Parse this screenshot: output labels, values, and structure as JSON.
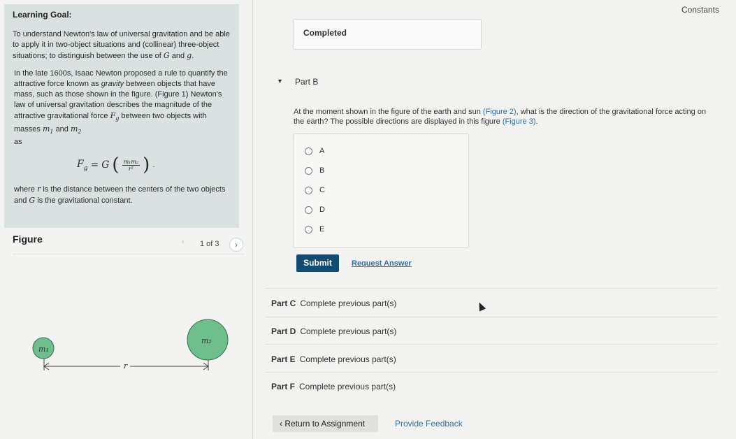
{
  "goal": {
    "title": "Learning Goal:",
    "intro_a": "To understand Newton's law of universal gravitation and be able to apply it in two-object situations and (collinear) three-object situations; to distinguish between the use of",
    "intro_G": "G",
    "intro_and": "and",
    "intro_g": "g",
    "intro_end": ".",
    "body_a": "In the late 1600s, Isaac Newton proposed a rule to quantify the attractive force known as",
    "body_gravity": "gravity",
    "body_b": "between objects that have mass, such as those shown in the figure. (Figure 1) Newton's law of universal gravitation describes the magnitude of the attractive gravitational force",
    "body_F": "F",
    "body_c": "between two objects with masses",
    "body_m1": "m",
    "body_and": "and",
    "body_m2": "m",
    "body_d": "as",
    "eq_lhs": "F",
    "eq_G": "G",
    "eq_num": "m₁m₂",
    "eq_den": "r²",
    "where_a": "where",
    "where_r": "r",
    "where_b": "is the distance between the centers of the two objects and",
    "where_G": "G",
    "where_c": "is the gravitational constant."
  },
  "figure": {
    "title": "Figure",
    "pager": "1 of 3",
    "label_m1": "m₁",
    "label_m2": "m₂",
    "label_r": "r"
  },
  "header": {
    "constants": "Constants"
  },
  "completed_label": "Completed",
  "part_b": {
    "title": "Part B",
    "question_a": "At the moment shown in the figure of the earth and sun",
    "link_fig2": "(Figure 2)",
    "question_b": ", what is the direction of the gravitational force acting on the earth? The possible directions are displayed in this figure",
    "link_fig3": "(Figure 3)",
    "question_c": ".",
    "options": [
      "A",
      "B",
      "C",
      "D",
      "E"
    ],
    "submit": "Submit",
    "request": "Request Answer"
  },
  "parts": [
    {
      "label": "Part C",
      "status": "Complete previous part(s)"
    },
    {
      "label": "Part D",
      "status": "Complete previous part(s)"
    },
    {
      "label": "Part E",
      "status": "Complete previous part(s)"
    },
    {
      "label": "Part F",
      "status": "Complete previous part(s)"
    }
  ],
  "footer": {
    "return": "Return to Assignment",
    "feedback": "Provide Feedback"
  },
  "colors": {
    "accent": "#134b70",
    "link": "#2f6fa0",
    "goal_bg": "#d9e2e0",
    "sphere": "#6fbf8c"
  }
}
